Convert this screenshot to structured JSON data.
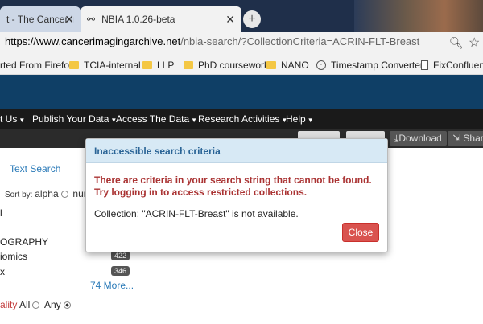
{
  "browser": {
    "tabs": [
      {
        "label": "t - The Cancer Ima",
        "close": "✕"
      },
      {
        "label": "NBIA 1.0.26-beta",
        "close": "✕"
      }
    ],
    "new_tab": "+",
    "url_host": "https://www.cancerimagingarchive.net",
    "url_rest": "/nbia-search/?CollectionCriteria=ACRIN-FLT-Breast",
    "bookmarks": [
      {
        "label": "rted From Firefo",
        "icon": "none"
      },
      {
        "label": "TCIA-internal",
        "icon": "folder-icon"
      },
      {
        "label": "LLP",
        "icon": "folder-icon"
      },
      {
        "label": "PhD coursework",
        "icon": "folder-icon"
      },
      {
        "label": "NANO",
        "icon": "folder-icon"
      },
      {
        "label": "Timestamp Converter",
        "icon": "clock-icon"
      },
      {
        "label": "FixConfluence",
        "icon": "page-icon"
      }
    ]
  },
  "nav": {
    "items": [
      {
        "label": "t Us"
      },
      {
        "label": "Publish Your Data"
      },
      {
        "label": "Access The Data"
      },
      {
        "label": "Research Activities"
      },
      {
        "label": "Help"
      }
    ]
  },
  "toolbar": {
    "download": "Download",
    "share": "Share"
  },
  "sidebar": {
    "text_search": "Text Search",
    "sort_by": "Sort by:",
    "sort_alpha": "alpha",
    "sort_num": "num",
    "row1": "l",
    "rows": [
      {
        "label": "OGRAPHY",
        "count": ""
      },
      {
        "label": "iomics",
        "count": "422"
      },
      {
        "label": "x",
        "count": "346"
      }
    ],
    "more": "74 More...",
    "modality_label": "ality",
    "modality_all": "All",
    "modality_any": "Any"
  },
  "modal": {
    "title": "Inaccessible search criteria",
    "error_line1": "There are criteria in your search string that cannot be found.",
    "error_line2": "Try logging in to access restricted collections.",
    "info": "Collection: \"ACRIN-FLT-Breast\" is not available.",
    "close_label": "Close"
  }
}
